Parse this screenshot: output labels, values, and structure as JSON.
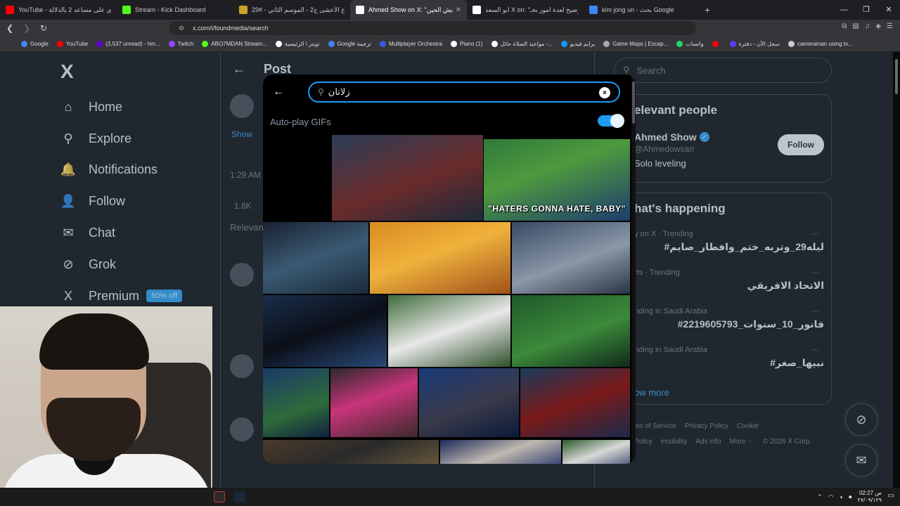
{
  "browser": {
    "tabs": [
      {
        "title": "YouTube - ردي على مساعد 2 بالدلالة",
        "color": "#ff0000"
      },
      {
        "title": "Stream - Kick Dashboard",
        "color": "#53fc18"
      },
      {
        "title": "شارع الأعشى ج2 - الموسم الثاني - #29",
        "color": "#c9a227"
      },
      {
        "title": "Ahmed Show on X: \"يش الحين",
        "color": "#ffffff",
        "active": true
      },
      {
        "title": "ابو السعد X on: \"توضيح لعدة امور بخـ",
        "color": "#ffffff"
      },
      {
        "title": "kim jong un - بحث Google",
        "color": "#4285f4"
      }
    ],
    "new_tab": "+",
    "window_controls": [
      "—",
      "❐",
      "✕"
    ],
    "url": "x.com/i/foundmedia/search",
    "bookmarks": [
      {
        "label": "Google",
        "color": "#4285f4"
      },
      {
        "label": "YouTube",
        "color": "#ff0000"
      },
      {
        "label": "(3,537 unread) - hm...",
        "color": "#6001d2"
      },
      {
        "label": "Twitch",
        "color": "#9146ff"
      },
      {
        "label": "ABO7MDAN Stream...",
        "color": "#53fc18"
      },
      {
        "label": "تويتر \\ الرئيسية",
        "color": "#ffffff"
      },
      {
        "label": "Google ترجمة",
        "color": "#4285f4"
      },
      {
        "label": "Multiplayer Orchestra",
        "color": "#3b5bdb"
      },
      {
        "label": "Piano (1)",
        "color": "#ffffff"
      },
      {
        "label": "مواعيد الصلاة حائل -...",
        "color": "#ffffff"
      },
      {
        "label": "برايم فيديو",
        "color": "#1a98ff"
      },
      {
        "label": "Game Maps | Escap...",
        "color": "#aaaaaa"
      },
      {
        "label": "واتساب",
        "color": "#25d366"
      },
      {
        "label": "",
        "color": "#ff0000"
      },
      {
        "label": "سجل الآن - دفترة",
        "color": "#5c3dff"
      },
      {
        "label": "cameraman using tv...",
        "color": "#cccccc"
      }
    ]
  },
  "sidebar": {
    "logo": "X",
    "items": [
      {
        "label": "Home",
        "icon": "home-icon",
        "glyph": "⌂"
      },
      {
        "label": "Explore",
        "icon": "search-icon",
        "glyph": "⚲"
      },
      {
        "label": "Notifications",
        "icon": "bell-icon",
        "glyph": "🔔"
      },
      {
        "label": "Follow",
        "icon": "follow-icon",
        "glyph": "👤"
      },
      {
        "label": "Chat",
        "icon": "mail-icon",
        "glyph": "✉"
      },
      {
        "label": "Grok",
        "icon": "grok-icon",
        "glyph": "⊘"
      },
      {
        "label": "Premium",
        "icon": "x-premium-icon",
        "glyph": "X",
        "badge": "50% off"
      }
    ]
  },
  "post": {
    "back": "←",
    "title": "Post",
    "show_label": "Show",
    "time": "1:29 AM",
    "replies": "1.8K",
    "relevant": "Relevan"
  },
  "right": {
    "search_placeholder": "Search",
    "relevant_title": "elevant people",
    "person": {
      "name": "Ahmed Show",
      "handle": "@Ahmedowsari",
      "bio": "Solo leveling",
      "follow": "Follow"
    },
    "happening_title": "hat's happening",
    "trends": [
      {
        "context": "y on X · Trending",
        "title": "#ليله29_وتربه_ختم_وافطار_صايم"
      },
      {
        "context": "rts · Trending",
        "title": "الاتحاد الافريقي"
      },
      {
        "context": "nding in Saudi Arabia",
        "title": "#فانور_10_سنوات_2219605793"
      },
      {
        "context": "nding in Saudi Arabia",
        "title": "#نبيها_صغر"
      }
    ],
    "show_more": "ow more",
    "footer": [
      "ms of Service",
      "Privacy Policy",
      "Cookie Policy",
      "essibility",
      "Ads info",
      "More ···",
      "© 2026 X Corp."
    ]
  },
  "gif_modal": {
    "back": "←",
    "query": "زلاتان",
    "clear": "×",
    "autoplay_label": "Auto-play GIFs",
    "autoplay_on": true,
    "gifs": [
      {
        "caption": "",
        "bg": "linear-gradient(160deg,#6b6e6a,#9a9d94 50,#585a57)"
      },
      {
        "caption": "",
        "bg": "linear-gradient(160deg,#2c3e57,#6a2b2b 55%,#1d2a3a)"
      },
      {
        "caption": "\"HATERS GONNA HATE, BABY\"",
        "bg": "linear-gradient(160deg,#2f7a3a,#4e9a3e 40%,#1d3c6e)"
      },
      {
        "caption": "",
        "bg": "linear-gradient(160deg,#1a2233,#3a5a72 50%,#1a2a3a)"
      },
      {
        "caption": "",
        "bg": "linear-gradient(160deg,#d98b1f,#f0b23c 45%,#a0521a)"
      },
      {
        "caption": "",
        "bg": "linear-gradient(160deg,#3a4a63,#8a97a8 55%,#2a3447)"
      },
      {
        "caption": "",
        "bg": "linear-gradient(160deg,#1a2d4a,#0b0f18 50%,#2a4a7a)"
      },
      {
        "caption": "",
        "bg": "linear-gradient(160deg,#3f6b3a,#e8e8e8 50%,#2d4f2a)"
      },
      {
        "caption": "",
        "bg": "linear-gradient(160deg,#1f5a2a,#3c8a3a 55%,#0f2a1a)"
      },
      {
        "caption": "",
        "bg": "linear-gradient(160deg,#1a3a6a,#2e6b3a 60%,#102040)"
      },
      {
        "caption": "",
        "bg": "linear-gradient(160deg,#2a2a2a,#c8347a 45%,#3a2a2a)"
      },
      {
        "caption": "",
        "bg": "linear-gradient(160deg,#1a3a7a,#3a3a4a 55%,#0a1a3a)"
      },
      {
        "caption": "",
        "bg": "linear-gradient(160deg,#1a3a5a,#7a1a1a 50%,#1a2a4a)"
      },
      {
        "caption": "",
        "bg": "linear-gradient(160deg,#4a3a2a,#2a2a2a 50%,#6a5a3a)"
      },
      {
        "caption": "",
        "bg": "linear-gradient(160deg,#1a2a5a,#c0b8b0 50%,#2a3a6a)"
      },
      {
        "caption": "",
        "bg": "linear-gradient(160deg,#2a5a2a,#d8d8d8 50%,#3a4a6a)"
      }
    ]
  },
  "taskbar": {
    "tray_time": "02:27 ص",
    "tray_date": "٢٧/٠٩/١٢٩"
  }
}
